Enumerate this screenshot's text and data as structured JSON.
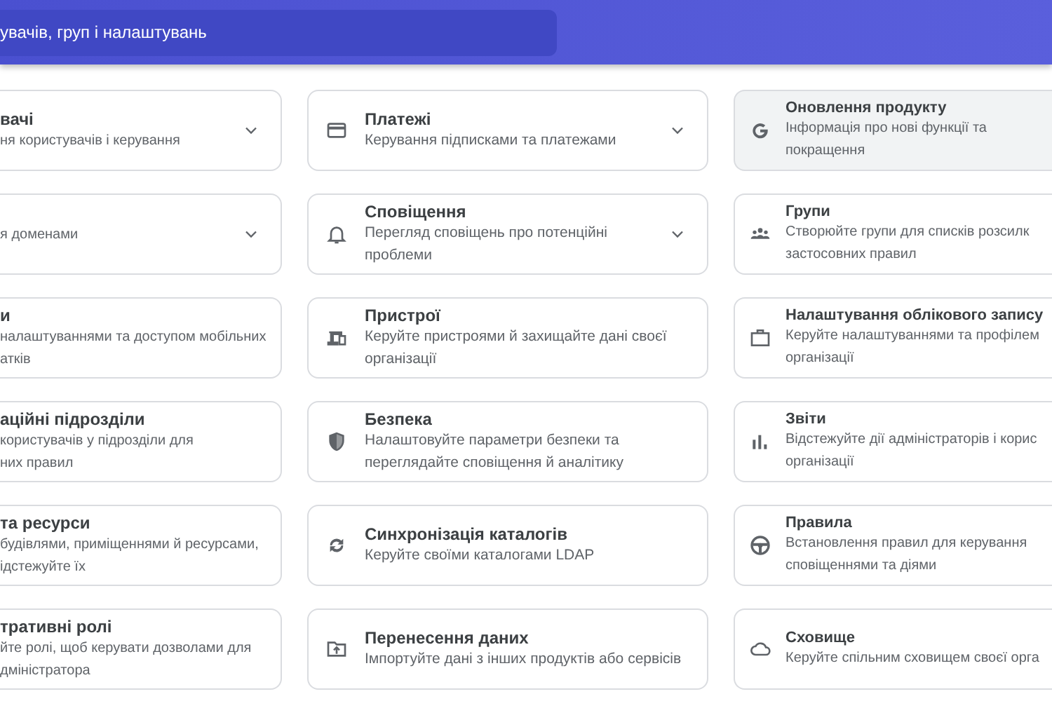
{
  "search": {
    "placeholder": "увачів, груп і налаштувань"
  },
  "columns": [
    {
      "cards": [
        {
          "title": "вачі",
          "description": [
            "ня користувачів і керування"
          ],
          "expandable": true,
          "selected": false
        },
        {
          "description": [
            "я доменами"
          ],
          "expandable": true,
          "selected": false
        },
        {
          "title": "и",
          "description": [
            "налаштуваннями та доступом мобільних",
            "атків"
          ],
          "expandable": false,
          "selected": false
        },
        {
          "title": "аційні підрозділи",
          "description": [
            "користувачів у підрозділи для",
            "них правил"
          ],
          "expandable": false,
          "selected": false
        },
        {
          "title": "та ресурси",
          "description": [
            "будівлями, приміщеннями й ресурсами,",
            "ідстежуйте їх"
          ],
          "expandable": false,
          "selected": false
        },
        {
          "title": "тративні ролі",
          "description": [
            "йте ролі, щоб керувати дозволами для",
            "дміністратора"
          ],
          "expandable": false,
          "selected": false
        }
      ]
    },
    {
      "cards": [
        {
          "title": "Платежі",
          "description": [
            "Керування підписками та платежами"
          ],
          "expandable": true,
          "selected": false
        },
        {
          "title": "Сповіщення",
          "description": [
            "Перегляд сповіщень про потенційні",
            "проблеми"
          ],
          "expandable": true,
          "selected": false
        },
        {
          "title": "Пристрої",
          "description": [
            "Керуйте пристроями й захищайте дані своєї",
            "організації"
          ],
          "expandable": false,
          "selected": false
        },
        {
          "title": "Безпека",
          "description": [
            "Налаштовуйте параметри безпеки та",
            "переглядайте сповіщення й аналітику"
          ],
          "expandable": false,
          "selected": false
        },
        {
          "title": "Синхронізація каталогів",
          "description": [
            "Керуйте своїми каталогами LDAP"
          ],
          "expandable": false,
          "selected": false
        },
        {
          "title": "Перенесення даних",
          "description": [
            "Імпортуйте дані з інших продуктів або сервісів"
          ],
          "expandable": false,
          "selected": false
        }
      ]
    },
    {
      "cards": [
        {
          "title": "Оновлення продукту",
          "description": [
            "Інформація про нові функції та",
            "покращення"
          ],
          "expandable": false,
          "selected": true
        },
        {
          "title": "Групи",
          "description": [
            "Створюйте групи для списків розсилк",
            "застосовних правил"
          ],
          "expandable": false,
          "selected": false
        },
        {
          "title": "Налаштування облікового запису",
          "description": [
            "Керуйте налаштуваннями та профілем",
            "організації"
          ],
          "expandable": false,
          "selected": false
        },
        {
          "title": "Звіти",
          "description": [
            "Відстежуйте дії адміністраторів і корис",
            "організації"
          ],
          "expandable": false,
          "selected": false
        },
        {
          "title": "Правила",
          "description": [
            "Встановлення правил для керування",
            "сповіщеннями та діями"
          ],
          "expandable": false,
          "selected": false
        },
        {
          "title": "Сховище",
          "description": [
            "Керуйте спільним сховищем своєї орга"
          ],
          "expandable": false,
          "selected": false
        }
      ]
    }
  ]
}
